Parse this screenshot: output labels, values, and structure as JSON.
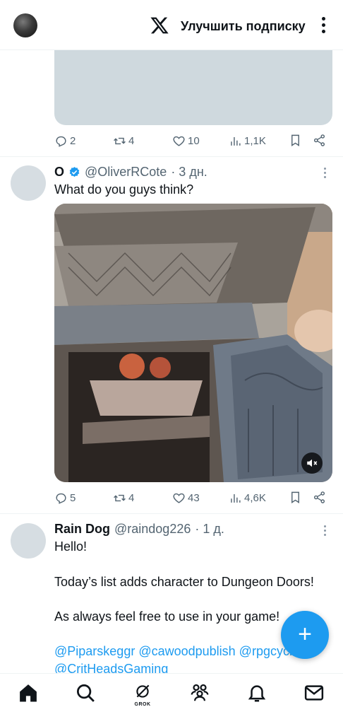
{
  "header": {
    "upgrade_label": "Улучшить подписку",
    "logo": "x-logo",
    "more": "more-icon"
  },
  "tweets": [
    {
      "stats": {
        "replies": "2",
        "reposts": "4",
        "likes": "10",
        "views": "1,1K"
      }
    },
    {
      "name": "O",
      "verified": true,
      "handle": "@OliverRCote",
      "time": "· 3 дн.",
      "text": "What do you guys think?",
      "media": "video",
      "stats": {
        "replies": "5",
        "reposts": "4",
        "likes": "43",
        "views": "4,6K"
      }
    },
    {
      "name": "Rain Dog",
      "handle": "@raindog226",
      "time": "· 1 д.",
      "lines": [
        "Hello!",
        "Today’s list adds character to Dungeon Doors!",
        "As always feel free to use in your game!",
        "@Piparskeggr @cawoodpublish @rpgcyclopte",
        "@CritHeadsGaming"
      ]
    }
  ],
  "fab": {
    "label": "+"
  },
  "nav": {
    "items": [
      "home-icon",
      "search-icon",
      "grok-icon",
      "communities-icon",
      "notifications-icon",
      "messages-icon"
    ],
    "grok_label": "GROK"
  },
  "colors": {
    "accent": "#1d9bf0",
    "text": "#0f1419",
    "muted": "#536471",
    "border": "#eff3f4"
  }
}
